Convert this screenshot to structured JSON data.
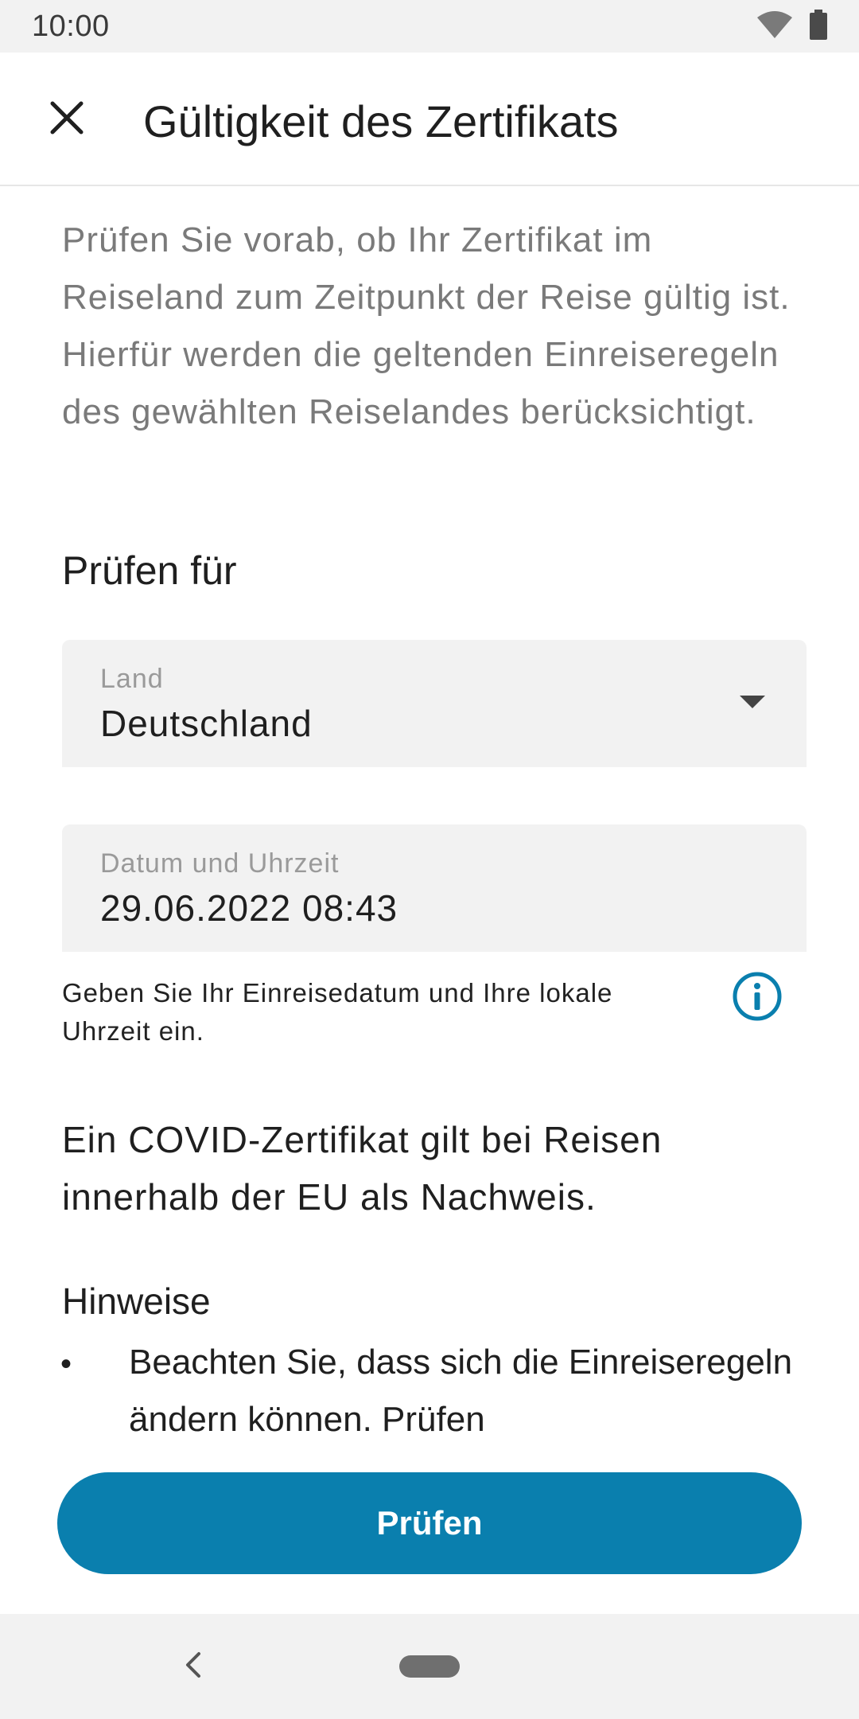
{
  "status_bar": {
    "time": "10:00",
    "icons": [
      "wifi-icon",
      "battery-icon"
    ]
  },
  "app_bar": {
    "close_icon": "close-icon",
    "title": "Gültigkeit des Zertifikats"
  },
  "intro": {
    "text": "Prüfen Sie vorab, ob Ihr Zertifikat im Reiseland zum Zeitpunkt der Reise gültig ist. Hierfür werden die geltenden Einreiseregeln des gewählten Reiselandes berücksichtigt."
  },
  "check_for": {
    "title": "Prüfen für"
  },
  "country_field": {
    "label": "Land",
    "value": "Deutschland",
    "icon": "dropdown-arrow-icon"
  },
  "datetime_field": {
    "label": "Datum und Uhrzeit",
    "value": "29.06.2022 08:43"
  },
  "helper": {
    "text": "Geben Sie Ihr Einreisedatum und Ihre lokale Uhrzeit ein.",
    "icon": "info-icon"
  },
  "statement": {
    "text": "Ein COVID-Zertifikat gilt bei Reisen innerhalb der EU als Nachweis."
  },
  "notes": {
    "title": "Hinweise",
    "items": [
      "Beachten Sie, dass sich die Einreiseregeln ändern können. Prüfen"
    ]
  },
  "primary_button": {
    "label": "Prüfen"
  },
  "colors": {
    "accent": "#0a7fae",
    "muted_text": "#7a7a7a",
    "field_background": "#f2f2f2"
  },
  "nav_bar": {
    "icons": [
      "back-icon",
      "home-pill-icon"
    ]
  }
}
